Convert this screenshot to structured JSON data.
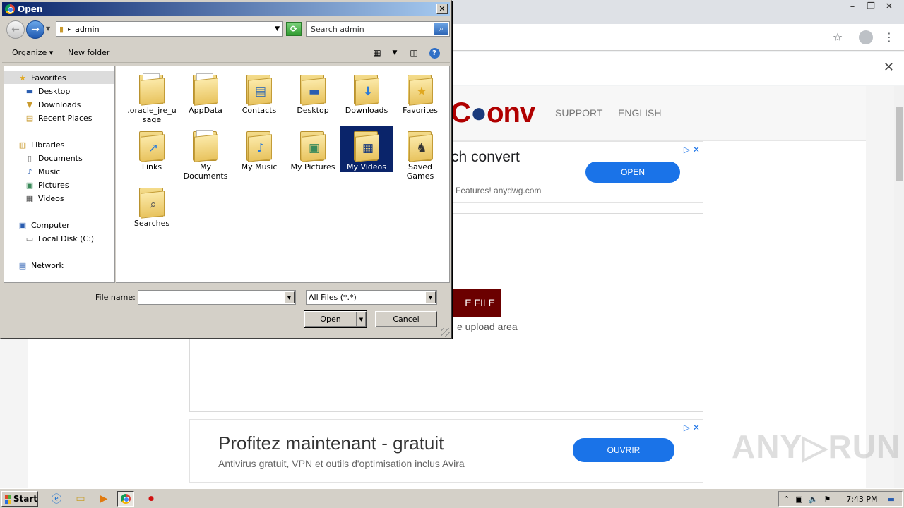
{
  "browser": {
    "window_controls": {
      "minimize": "–",
      "restore": "❐",
      "close": "✕"
    },
    "bookmark_icon": "star-icon",
    "profile_icon": "avatar",
    "menu_icon": "⋮",
    "notification_close": "✕",
    "site": {
      "logo_tail": "onv",
      "nav": [
        "SUPPORT",
        "ENGLISH"
      ],
      "ad1": {
        "title": "ch convert",
        "subtitle": "Features! anydwg.com",
        "button": "OPEN"
      },
      "upload": {
        "button": "E FILE",
        "hint": "e upload area"
      },
      "ad2": {
        "title": "Profitez maintenant - gratuit",
        "subtitle": "Antivirus gratuit, VPN et outils d'optimisation inclus Avira",
        "button": "OUVRIR"
      },
      "watermark": "ANY▷RUN"
    }
  },
  "dialog": {
    "title": "Open",
    "address": "admin",
    "search_placeholder": "Search admin",
    "toolbar": {
      "organize": "Organize",
      "new_folder": "New folder",
      "help": "?"
    },
    "nav": {
      "favorites": "Favorites",
      "favorites_items": [
        "Desktop",
        "Downloads",
        "Recent Places"
      ],
      "libraries": "Libraries",
      "libraries_items": [
        "Documents",
        "Music",
        "Pictures",
        "Videos"
      ],
      "computer": "Computer",
      "computer_items": [
        "Local Disk (C:)"
      ],
      "network": "Network"
    },
    "files": [
      {
        "name": ".oracle_jre_u sage",
        "icon": "folder-paper"
      },
      {
        "name": "AppData",
        "icon": "folder-empty"
      },
      {
        "name": "Contacts",
        "icon": "contacts"
      },
      {
        "name": "Desktop",
        "icon": "desktop"
      },
      {
        "name": "Downloads",
        "icon": "download-arrow"
      },
      {
        "name": "Favorites",
        "icon": "star"
      },
      {
        "name": "Links",
        "icon": "link-arrow"
      },
      {
        "name": "My Documents",
        "icon": "document"
      },
      {
        "name": "My Music",
        "icon": "music-note"
      },
      {
        "name": "My Pictures",
        "icon": "landscape"
      },
      {
        "name": "My Videos",
        "icon": "film",
        "selected": true
      },
      {
        "name": "Saved Games",
        "icon": "chess-piece"
      },
      {
        "name": "Searches",
        "icon": "magnifier"
      }
    ],
    "file_name_label": "File name:",
    "file_name_value": "",
    "file_type": "All Files (*.*)",
    "open_label": "Open",
    "cancel_label": "Cancel"
  },
  "taskbar": {
    "start": "Start",
    "time": "7:43 PM"
  }
}
